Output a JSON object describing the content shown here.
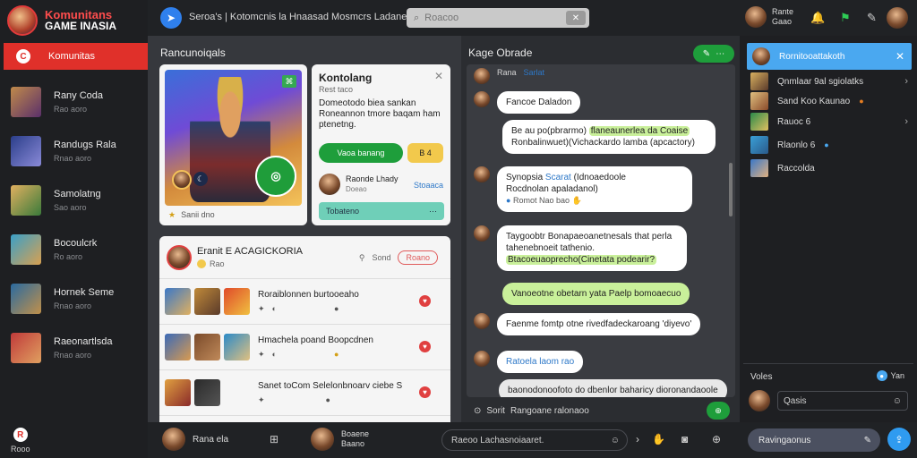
{
  "brand": {
    "line1": "Komunitans",
    "line2": "GAME INASIA"
  },
  "sidebar": {
    "active": {
      "icon": "C",
      "label": "Komunitas"
    },
    "items": [
      {
        "title": "Rany Coda",
        "sub": "Rao aoro"
      },
      {
        "title": "Randugs Rala",
        "sub": "Rnao aoro"
      },
      {
        "title": "Samolatng",
        "sub": "Sao aoro"
      },
      {
        "title": "Bocoulcrk",
        "sub": "Ro aoro"
      },
      {
        "title": "Hornek Seme",
        "sub": "Rnao aoro"
      },
      {
        "title": "Raeonartlsda",
        "sub": "Rnao aoro"
      }
    ],
    "footer": {
      "icon": "R",
      "label": "Rooo"
    }
  },
  "topbar": {
    "title": "Seroa's | Kotomcnis la Hnaasad Mosmcrs Ladanen",
    "search_placeholder": "Roacoo",
    "search_clear": "✕",
    "user_name": "Rante",
    "user_sub": "Gaao"
  },
  "main": {
    "title": "Rancunoiqals",
    "feature": {
      "caption": "Sanii dno"
    },
    "detail": {
      "title": "Kontolang",
      "subtitle": "Rest taco",
      "description": "Domeotodo biea sankan Roneannon tmore baqam ham ptenetng.",
      "primary_button": "Vaoa banang",
      "secondary_button": "B 4",
      "host_name": "Raonde Lhady",
      "host_sub": "Doeao",
      "host_link": "Stoaaca",
      "bar_label": "Tobateno",
      "bar_dots": "⋯"
    },
    "list": {
      "title": "Eranit E ACAGICKORIA",
      "sub": "Rao",
      "right_label": "Sond",
      "tag": "Roano",
      "rows": [
        {
          "title": "Roraiblonnen burtooeaho"
        },
        {
          "title": "Hmachela poand Boopcdnen"
        },
        {
          "title": "Sanet toCom Selelonbnoarv ciebe S"
        }
      ]
    }
  },
  "chat": {
    "title": "Kage Obrade",
    "send_label": "⋯",
    "header_msg": {
      "name": "Rana",
      "link": "Sarlat"
    },
    "messages": [
      {
        "text": "Fancoe Daladon"
      },
      {
        "pre": "Be au po(pbrarmo) ",
        "mark": "flaneaunerlea da Coaise",
        "line2": "Ronbalinwuet)(Vichackardo lamba (apcactory)"
      },
      {
        "name": "Synopsia",
        "link": "Scarat",
        "rest": " (Idnoaedoole",
        "line2": "Rocdnolan apaladanol)",
        "meta": "Romot Nao bao"
      },
      {
        "text": "Taygoobtr Bonapaeoanetnesals that perla tahenebnoeit tathenio.",
        "green": "Btacoeuaoprecho(Cinetata podearir?"
      },
      {
        "text": "Vanoeotne obetarn yata Paelp bomoaecuo"
      },
      {
        "text": "Faenme fomtp otne rivedfadeckaroang 'diyevo'"
      },
      {
        "text": "Ratoela laom rao"
      },
      {
        "text": "baonodonoofoto do dbenlor baharicy dioronandaoole"
      }
    ],
    "input_label": "Sorit",
    "input_text": "Rangoane ralonaoo",
    "input_send": "⊕"
  },
  "rpanel": {
    "active": "Rornitooattakoth",
    "items": [
      {
        "label": "Qnmlaar 9al sgiolatks"
      },
      {
        "label": "Sand Koo Kaunao"
      },
      {
        "label": "Rauoc 6"
      },
      {
        "label": "Rlaonlo 6"
      },
      {
        "label": "Raccolda"
      }
    ],
    "voice_label": "Voles",
    "voice_right": "Yan",
    "voice_field": "Qasis"
  },
  "bottombar": {
    "user1_name": "Rana ela",
    "user2_name": "Boaene",
    "user2_sub": "Baano",
    "input1": "Raeoo Lachasnoiaaret.",
    "input2": "Ravingaonus"
  }
}
